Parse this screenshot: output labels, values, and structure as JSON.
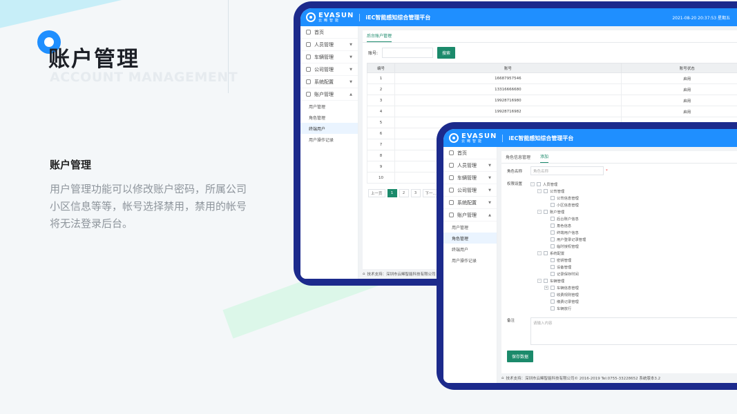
{
  "page": {
    "title": "账户管理",
    "subtitle": "ACCOUNT MANAGEMENT",
    "section_heading": "账户管理",
    "description": "用户管理功能可以修改账户密码，所属公司小区信息等等，帐号选择禁用，禁用的帐号将无法登录后台。"
  },
  "app": {
    "logo_name": "EVASUN",
    "logo_cn": "云晞智能",
    "title": "iEC智能感知综合管理平台",
    "datetime": "2021-08-20  20:37:53  星期五"
  },
  "sidebar": {
    "home": "首页",
    "items": [
      "人员管理",
      "车辆管理",
      "公司管理",
      "系统配置",
      "账户管理"
    ],
    "sub_items": [
      "用户管理",
      "角色管理",
      "终端用户",
      "用户操作记录"
    ]
  },
  "window1": {
    "tab": "后台账户管理",
    "search_label": "账号:",
    "search_button": "搜索",
    "columns": [
      "编号",
      "账号",
      "账号状态"
    ],
    "rows": [
      [
        "1",
        "16687957546",
        "启用"
      ],
      [
        "2",
        "13316666680",
        "启用"
      ],
      [
        "3",
        "19928716980",
        "启用"
      ],
      [
        "4",
        "19928716982",
        "启用"
      ],
      [
        "5",
        "",
        ""
      ],
      [
        "6",
        "",
        ""
      ],
      [
        "7",
        "",
        ""
      ],
      [
        "8",
        "",
        ""
      ],
      [
        "9",
        "",
        ""
      ],
      [
        "10",
        "",
        ""
      ]
    ],
    "pagination": [
      "上一页",
      "1",
      "2",
      "3",
      "下一..."
    ],
    "footer": "技术支持：深圳市云晞智能科技有限公司"
  },
  "window2": {
    "tabs": [
      "角色信息管理",
      "添加"
    ],
    "role_label": "角色名称",
    "role_placeholder": "角色名称",
    "required_mark": "*",
    "perm_label": "权限设置",
    "tree": [
      {
        "label": "人员管理",
        "level": 0,
        "toggle": "-"
      },
      {
        "label": "公司管理",
        "level": 1,
        "toggle": "-"
      },
      {
        "label": "公司信息管理",
        "level": 2,
        "toggle": ""
      },
      {
        "label": "小区信息管理",
        "level": 2,
        "toggle": ""
      },
      {
        "label": "账户管理",
        "level": 1,
        "toggle": "-"
      },
      {
        "label": "后台账户信息",
        "level": 2,
        "toggle": ""
      },
      {
        "label": "角色信息",
        "level": 2,
        "toggle": ""
      },
      {
        "label": "终端用户信息",
        "level": 2,
        "toggle": ""
      },
      {
        "label": "用户登录记录管理",
        "level": 2,
        "toggle": ""
      },
      {
        "label": "临时授权管理",
        "level": 2,
        "toggle": ""
      },
      {
        "label": "系统配置",
        "level": 1,
        "toggle": "-"
      },
      {
        "label": "密钥管理",
        "level": 2,
        "toggle": ""
      },
      {
        "label": "设备管理",
        "level": 2,
        "toggle": ""
      },
      {
        "label": "记录保存时间",
        "level": 2,
        "toggle": ""
      },
      {
        "label": "车辆管理",
        "level": 1,
        "toggle": "-"
      },
      {
        "label": "车辆信息管理",
        "level": 2,
        "toggle": "+"
      },
      {
        "label": "收费规则管理",
        "level": 2,
        "toggle": ""
      },
      {
        "label": "缴费记录管理",
        "level": 2,
        "toggle": ""
      },
      {
        "label": "车辆放行",
        "level": 2,
        "toggle": ""
      }
    ],
    "remark_label": "备注",
    "remark_placeholder": "请输入内容",
    "save_button": "保存数据",
    "footer": "技术支持：深圳市云晞智能科技有限公司© 2016-2019 Tel:0755-33228652 系统版本3.2"
  },
  "colors": {
    "frame": "#1c2a8c",
    "topbar": "#1f8fff",
    "accent_green": "#1b8a6b"
  }
}
